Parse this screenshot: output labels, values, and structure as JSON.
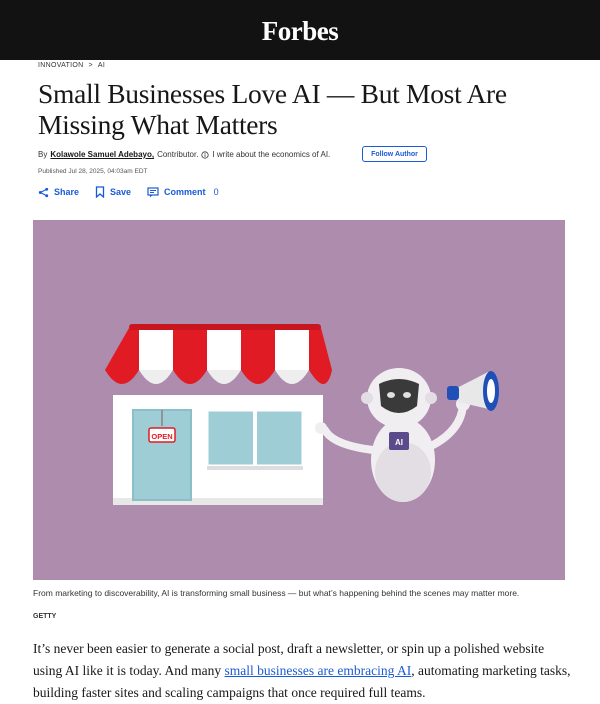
{
  "header": {
    "logo": "Forbes"
  },
  "breadcrumb": {
    "items": [
      "INNOVATION",
      "AI"
    ],
    "separator": ">"
  },
  "article": {
    "title": "Small Businesses Love AI — But Most Are Missing What Matters",
    "byline_prefix": "By",
    "author": "Kolawole Samuel Adebayo,",
    "author_role": "Contributor.",
    "author_bio": "I write about the economics of AI.",
    "follow_label": "Follow Author",
    "published": "Published Jul 28, 2025, 04:03am EDT",
    "actions": {
      "share": "Share",
      "save": "Save",
      "comment": "Comment",
      "comment_count": "0"
    }
  },
  "hero": {
    "sign_text": "OPEN",
    "robot_badge": "AI",
    "caption": "From marketing to discoverability, AI is transforming small business — but what’s happening behind the scenes may matter more.",
    "credit": "GETTY"
  },
  "body": {
    "p1_before": "It’s never been easier to generate a social post, draft a newsletter, or spin up a polished website using AI like it is today. And many ",
    "p1_link": "small businesses are embracing AI",
    "p1_after": ", automating marketing tasks, building faster sites and scaling campaigns that once required full teams."
  },
  "colors": {
    "accent": "#1a5ad6",
    "hero_bg": "#ad8cad",
    "header_bg": "#121212",
    "awning_red": "#e01b24"
  }
}
